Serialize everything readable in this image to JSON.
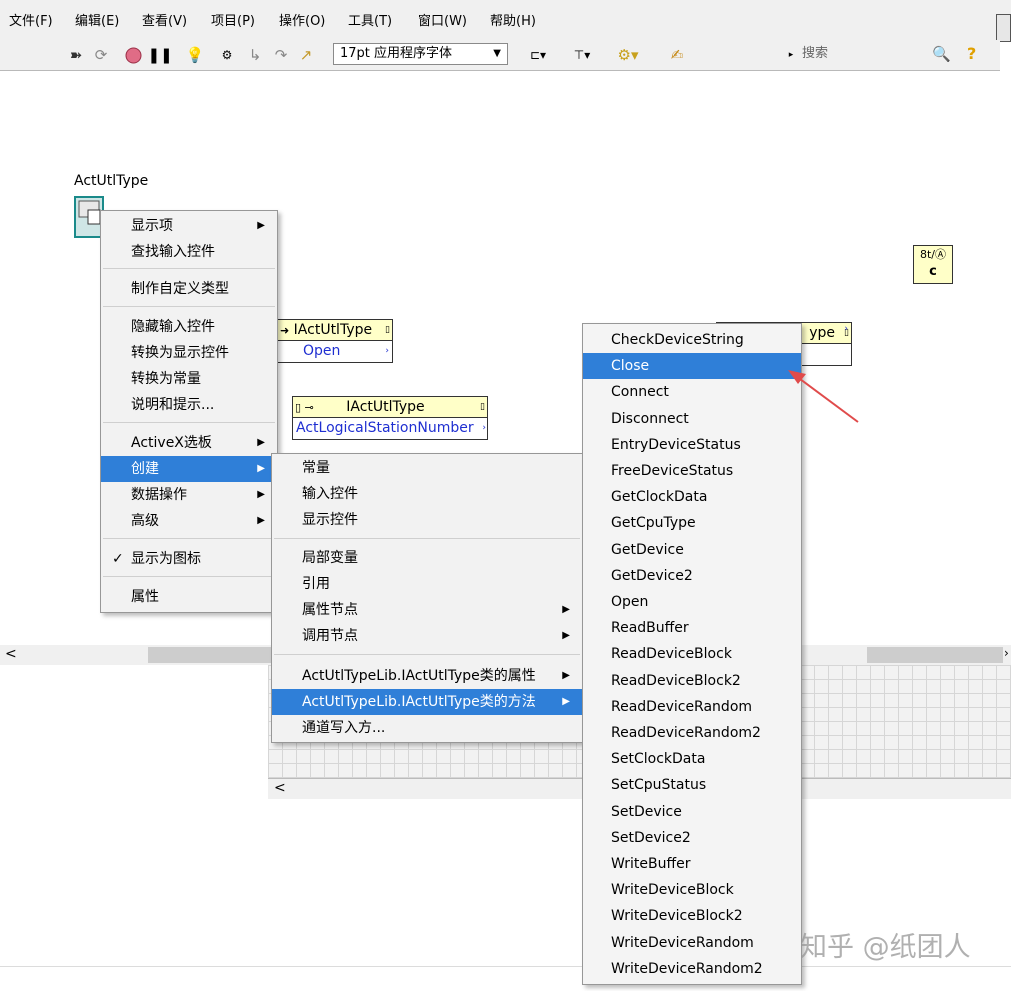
{
  "menubar": {
    "items": [
      "文件(F)",
      "编辑(E)",
      "查看(V)",
      "项目(P)",
      "操作(O)",
      "工具(T)",
      "窗口(W)",
      "帮助(H)"
    ]
  },
  "toolbar": {
    "font_select": "17pt 应用程序字体",
    "search_placeholder": "搜索"
  },
  "canvas": {
    "control_label": "ActUtlType",
    "node1": {
      "title": "IActUtlType",
      "method": "Open"
    },
    "node2": {
      "title": "IActUtlType",
      "property": "ActLogicalStationNumber"
    },
    "node3": {
      "title_partial": "ype"
    },
    "constant_tile": {
      "top": "8t/Ⓐ",
      "bottom": "c"
    }
  },
  "context_menu": {
    "items": [
      {
        "label": "显示项",
        "submenu": true
      },
      {
        "label": "查找输入控件"
      },
      {
        "label": "制作自定义类型"
      },
      {
        "label": "隐藏输入控件"
      },
      {
        "label": "转换为显示控件"
      },
      {
        "label": "转换为常量"
      },
      {
        "label": "说明和提示..."
      },
      {
        "label": "ActiveX选板",
        "submenu": true
      },
      {
        "label": "创建",
        "submenu": true,
        "selected": true
      },
      {
        "label": "数据操作",
        "submenu": true
      },
      {
        "label": "高级",
        "submenu": true
      },
      {
        "label": "显示为图标",
        "checked": true,
        "check": "✓"
      },
      {
        "label": "属性"
      }
    ]
  },
  "create_submenu": {
    "items": [
      {
        "label": "常量"
      },
      {
        "label": "输入控件"
      },
      {
        "label": "显示控件"
      },
      {
        "label": "局部变量"
      },
      {
        "label": "引用"
      },
      {
        "label": "属性节点",
        "submenu": true
      },
      {
        "label": "调用节点",
        "submenu": true
      },
      {
        "label": "ActUtlTypeLib.IActUtlType类的属性",
        "submenu": true
      },
      {
        "label": "ActUtlTypeLib.IActUtlType类的方法",
        "submenu": true,
        "selected": true
      },
      {
        "label": "通道写入方..."
      }
    ]
  },
  "methods_submenu": {
    "selected": "Close",
    "items": [
      "CheckDeviceString",
      "Close",
      "Connect",
      "Disconnect",
      "EntryDeviceStatus",
      "FreeDeviceStatus",
      "GetClockData",
      "GetCpuType",
      "GetDevice",
      "GetDevice2",
      "Open",
      "ReadBuffer",
      "ReadDeviceBlock",
      "ReadDeviceBlock2",
      "ReadDeviceRandom",
      "ReadDeviceRandom2",
      "SetClockData",
      "SetCpuStatus",
      "SetDevice",
      "SetDevice2",
      "WriteBuffer",
      "WriteDeviceBlock",
      "WriteDeviceBlock2",
      "WriteDeviceRandom",
      "WriteDeviceRandom2"
    ]
  },
  "scroll": {
    "left_arrow": "<",
    "right_arrow": "›"
  },
  "watermark": "知乎 @纸团人",
  "colors": {
    "selection": "#2f7fd8",
    "node_header": "#ffffc8",
    "node_text": "#1f2fd1",
    "arrow": "#e04b4b"
  }
}
